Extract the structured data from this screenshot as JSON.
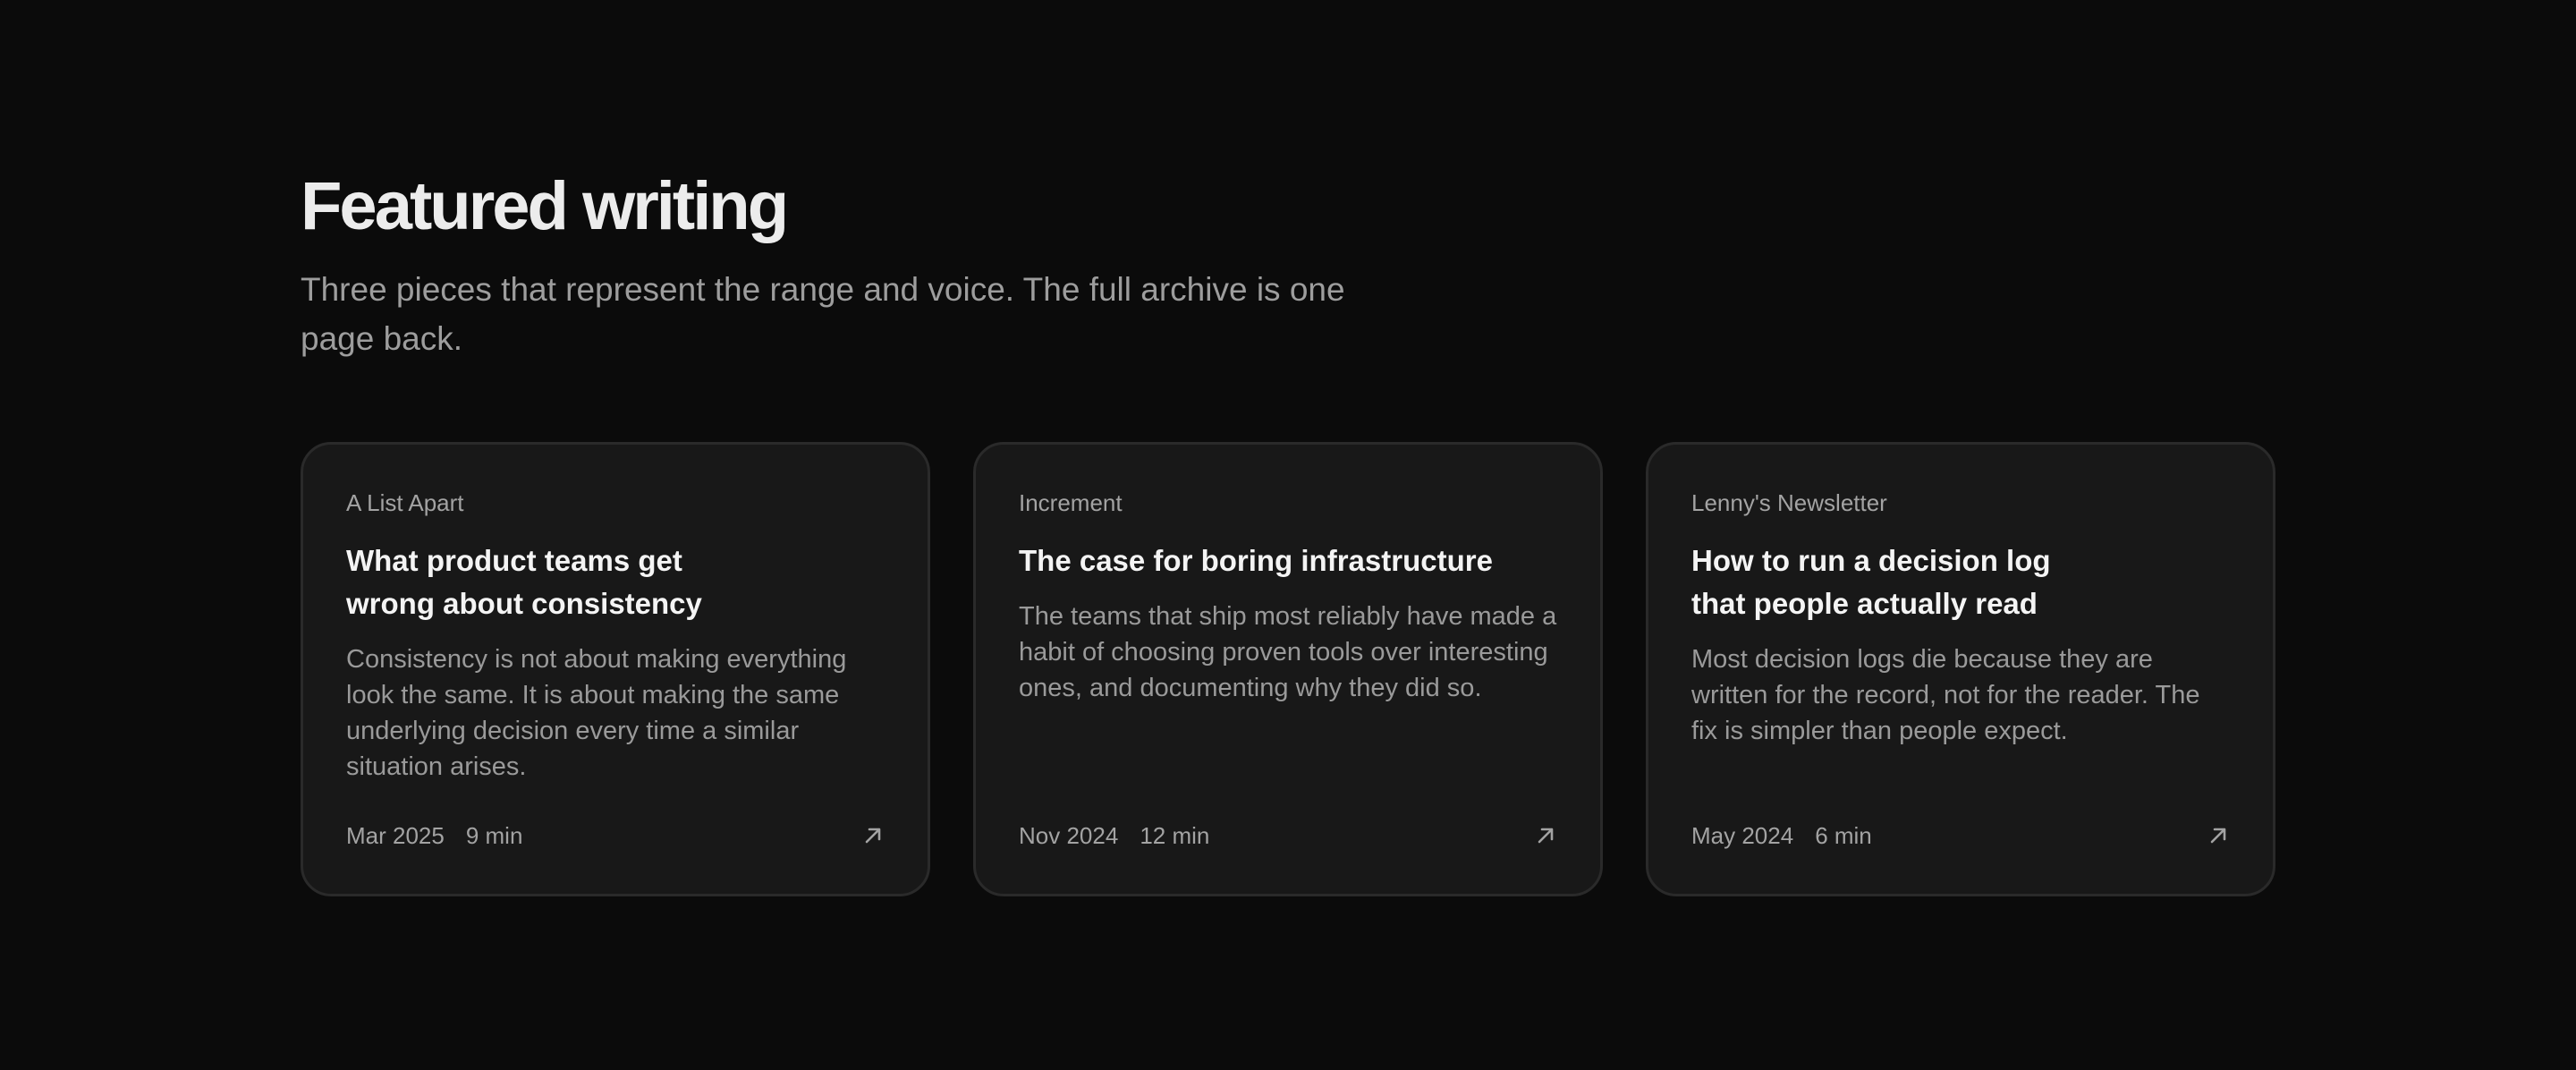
{
  "header": {
    "title": "Featured writing",
    "subtitle": "Three pieces that represent the range and voice. The full archive is one page back."
  },
  "cards": [
    {
      "publication": "A List Apart",
      "title_lines": [
        "What product teams get",
        "wrong about consistency"
      ],
      "excerpt": "Consistency is not about making everything look the same. It is about making the same underlying decision every time a similar situation arises.",
      "date": "Mar 2025",
      "read_time": "9 min",
      "icon": "arrow-up-right-icon"
    },
    {
      "publication": "Increment",
      "title_lines": [
        "The case for boring infrastructure"
      ],
      "excerpt": "The teams that ship most reliably have made a habit of choosing proven tools over interesting ones, and documenting why they did so.",
      "date": "Nov 2024",
      "read_time": "12 min",
      "icon": "arrow-up-right-icon"
    },
    {
      "publication": "Lenny's Newsletter",
      "title_lines": [
        "How to run a decision log",
        "that people actually read"
      ],
      "excerpt": "Most decision logs die because they are written for the record, not for the reader. The fix is simpler than people expect.",
      "date": "May 2024",
      "read_time": "6 min",
      "icon": "arrow-up-right-icon"
    }
  ],
  "colors": {
    "background": "#0b0b0b",
    "card_background": "#181818",
    "card_border": "#2a2a2a",
    "title_text": "#ececec",
    "muted_text": "#9d9d9d"
  }
}
